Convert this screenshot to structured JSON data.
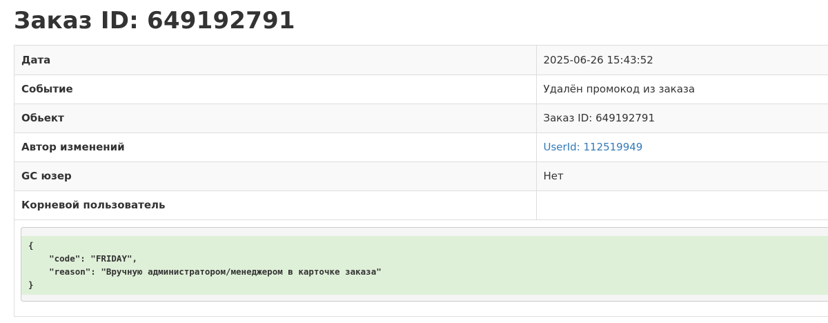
{
  "page": {
    "title": "Заказ ID: 649192791"
  },
  "details": [
    {
      "label": "Дата",
      "value": "2025-06-26 15:43:52",
      "link": false
    },
    {
      "label": "Событие",
      "value": "Удалён промокод из заказа",
      "link": false
    },
    {
      "label": "Обьект",
      "value": "Заказ ID: 649192791",
      "link": false
    },
    {
      "label": "Автор изменений",
      "value": "UserId: 112519949",
      "link": true
    },
    {
      "label": "GC юзер",
      "value": "Нет",
      "link": false
    },
    {
      "label": "Корневой пользователь",
      "value": "",
      "link": false
    }
  ],
  "payload": {
    "text": "{\n    \"code\": \"FRIDAY\",\n    \"reason\": \"Вручную администратором/менеджером в карточке заказа\"\n}"
  },
  "colors": {
    "link": "#337ab7",
    "payload_background": "#dff0d8",
    "row_stripe": "#f9f9f9",
    "border": "#dddddd"
  }
}
